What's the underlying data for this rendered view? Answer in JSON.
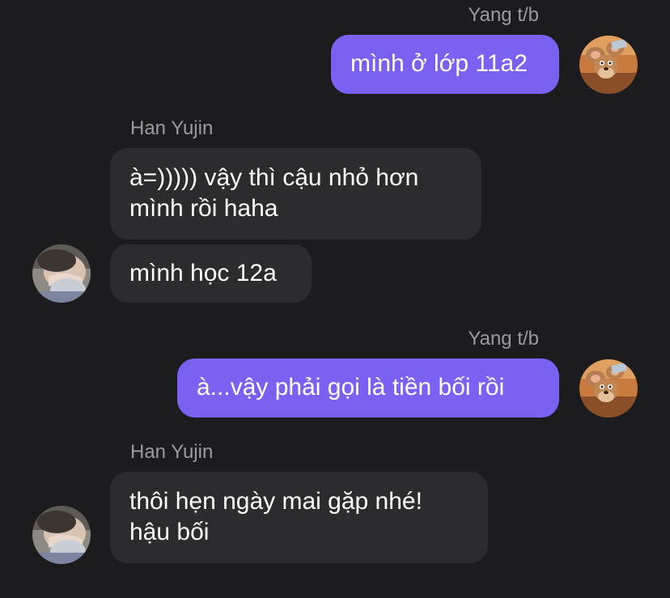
{
  "messages": [
    {
      "sender": "Yang t/b",
      "direction": "out",
      "lines": [
        "mình ở lớp 11a2"
      ]
    },
    {
      "sender": "Han Yujin",
      "direction": "in",
      "lines": [
        "à=))))) vậy thì cậu nhỏ hơn",
        "mình rồi haha"
      ]
    },
    {
      "sender": "Han Yujin",
      "direction": "in",
      "lines": [
        "mình học 12a"
      ]
    },
    {
      "sender": "Yang t/b",
      "direction": "out",
      "lines": [
        "à...vậy phải gọi là tiền bối rồi"
      ]
    },
    {
      "sender": "Han Yujin",
      "direction": "in",
      "lines": [
        "thôi hẹn ngày mai gặp nhé!",
        "hậu bối"
      ]
    }
  ],
  "avatars": {
    "yang": "cartoon-mouse-avatar",
    "han": "person-photo-avatar"
  },
  "colors": {
    "background": "#1c1c1e",
    "outgoing_bubble": "#7b60f2",
    "incoming_bubble": "#2c2c2e",
    "sender_label": "#9a9aa0"
  }
}
